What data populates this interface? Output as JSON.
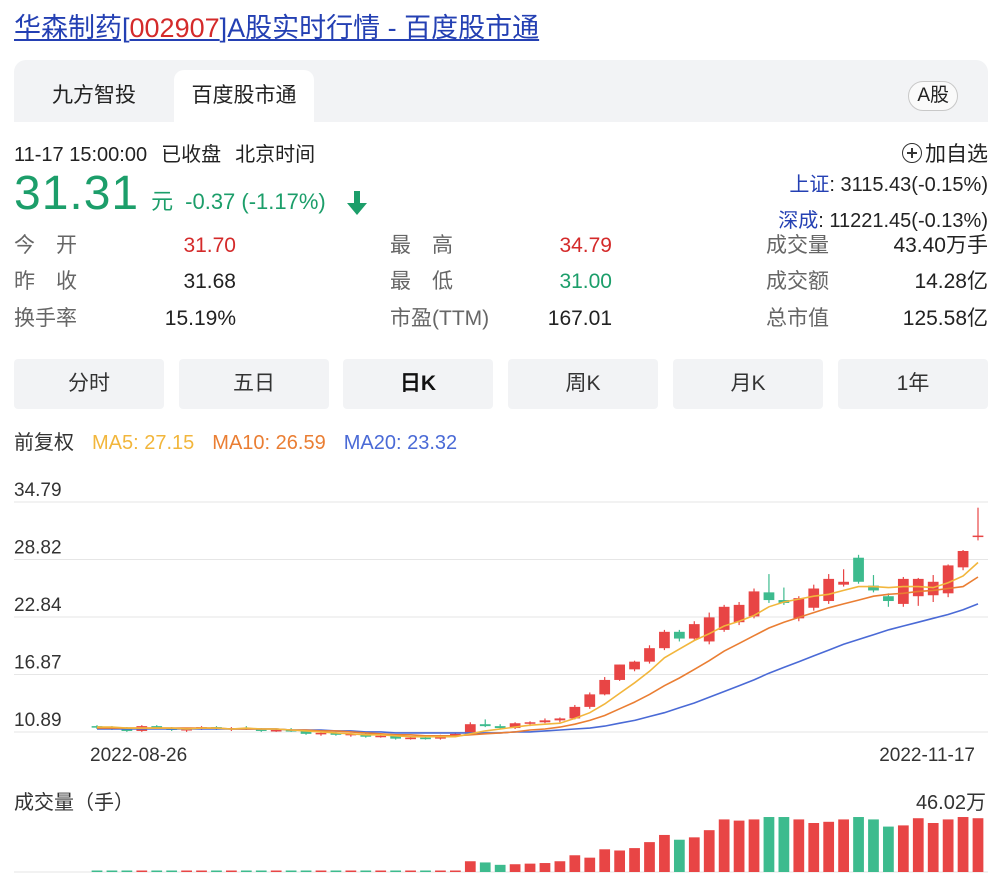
{
  "page": {
    "title_prefix": "华森制药[",
    "code": "002907",
    "title_suffix": "]A股实时行情 - 百度股市通"
  },
  "tabs": [
    "九方智投",
    "百度股市通"
  ],
  "share_type": "A股",
  "status": {
    "time": "11-17 15:00:00",
    "state": "已收盘",
    "zone": "北京时间"
  },
  "add_favorite": "加自选",
  "quote": {
    "price": "31.31",
    "unit": "元",
    "change": "-0.37 (-1.17%)",
    "direction": "down"
  },
  "indices": [
    {
      "name": "上证",
      "value": ": 3115.43(-0.15%)"
    },
    {
      "name": "深成",
      "value": ": 11221.45(-0.13%)"
    }
  ],
  "stats": {
    "open_label": "今　开",
    "open": "31.70",
    "prev_label": "昨　收",
    "prev": "31.68",
    "turnover_label": "换手率",
    "turnover": "15.19%",
    "high_label": "最　高",
    "high": "34.79",
    "low_label": "最　低",
    "low": "31.00",
    "pe_label": "市盈(TTM)",
    "pe": "167.01",
    "volume_label": "成交量",
    "volume": "43.40万手",
    "amount_label": "成交额",
    "amount": "14.28亿",
    "mcap_label": "总市值",
    "mcap": "125.58亿"
  },
  "periods": [
    "分时",
    "五日",
    "日K",
    "周K",
    "月K",
    "1年"
  ],
  "active_period": "日K",
  "ma": {
    "adjust": "前复权",
    "ma5": "MA5: 27.15",
    "ma10": "MA10: 26.59",
    "ma20": "MA20: 23.32"
  },
  "colors": {
    "up": "#e84545",
    "down": "#3dbb8e",
    "ma5": "#f2b63c",
    "ma10": "#ea7e33",
    "ma20": "#4a6ad6",
    "link": "#2440b3"
  },
  "chart_data": {
    "type": "candlestick",
    "y_ticks": [
      "34.79",
      "28.82",
      "22.84",
      "16.87",
      "10.89"
    ],
    "ylim": [
      10.89,
      34.79
    ],
    "x_labels": [
      "2022-08-26",
      "2022-11-17"
    ],
    "volume_title": "成交量（手）",
    "volume_max_label": "46.02万",
    "volume_max": 46.02,
    "candles": [
      [
        11.5,
        11.6,
        11.2,
        11.4
      ],
      [
        11.4,
        11.5,
        11.1,
        11.3
      ],
      [
        11.3,
        11.4,
        10.9,
        11.0
      ],
      [
        11.0,
        11.6,
        10.9,
        11.5
      ],
      [
        11.5,
        11.6,
        11.2,
        11.3
      ],
      [
        11.3,
        11.4,
        11.0,
        11.1
      ],
      [
        11.1,
        11.3,
        10.9,
        11.2
      ],
      [
        11.2,
        11.5,
        11.1,
        11.4
      ],
      [
        11.4,
        11.5,
        11.1,
        11.2
      ],
      [
        11.2,
        11.4,
        11.0,
        11.3
      ],
      [
        11.3,
        11.5,
        11.1,
        11.2
      ],
      [
        11.2,
        11.3,
        10.9,
        11.0
      ],
      [
        11.0,
        11.2,
        10.9,
        11.1
      ],
      [
        11.1,
        11.3,
        10.9,
        11.0
      ],
      [
        11.0,
        11.1,
        10.6,
        10.7
      ],
      [
        10.7,
        10.9,
        10.5,
        10.8
      ],
      [
        10.8,
        10.9,
        10.5,
        10.6
      ],
      [
        10.6,
        10.8,
        10.4,
        10.7
      ],
      [
        10.7,
        10.8,
        10.3,
        10.4
      ],
      [
        10.4,
        10.6,
        10.3,
        10.5
      ],
      [
        10.5,
        10.6,
        10.1,
        10.2
      ],
      [
        10.2,
        10.4,
        10.1,
        10.3
      ],
      [
        10.3,
        10.5,
        10.1,
        10.2
      ],
      [
        10.2,
        10.6,
        10.1,
        10.5
      ],
      [
        10.5,
        10.8,
        10.4,
        10.7
      ],
      [
        10.7,
        11.9,
        10.6,
        11.7
      ],
      [
        11.7,
        12.2,
        11.4,
        11.5
      ],
      [
        11.5,
        11.7,
        11.2,
        11.3
      ],
      [
        11.3,
        11.9,
        11.2,
        11.8
      ],
      [
        11.8,
        12.0,
        11.5,
        11.9
      ],
      [
        11.9,
        12.3,
        11.8,
        12.1
      ],
      [
        12.1,
        12.4,
        11.9,
        12.3
      ],
      [
        12.3,
        13.7,
        12.2,
        13.5
      ],
      [
        13.5,
        15.0,
        13.3,
        14.8
      ],
      [
        14.8,
        16.6,
        14.7,
        16.3
      ],
      [
        16.3,
        17.9,
        16.2,
        17.9
      ],
      [
        17.4,
        18.3,
        17.2,
        18.2
      ],
      [
        18.2,
        19.9,
        18.0,
        19.6
      ],
      [
        19.6,
        21.5,
        19.4,
        21.3
      ],
      [
        21.3,
        21.5,
        20.3,
        20.6
      ],
      [
        20.6,
        22.4,
        20.5,
        22.1
      ],
      [
        20.3,
        23.3,
        20.0,
        22.8
      ],
      [
        21.5,
        24.1,
        21.3,
        23.9
      ],
      [
        22.3,
        24.4,
        22.0,
        24.1
      ],
      [
        22.9,
        25.8,
        22.7,
        25.5
      ],
      [
        25.4,
        27.3,
        24.3,
        24.6
      ],
      [
        24.6,
        25.9,
        24.1,
        24.3
      ],
      [
        22.7,
        25.0,
        22.4,
        24.8
      ],
      [
        23.8,
        26.2,
        23.5,
        25.8
      ],
      [
        24.5,
        27.3,
        24.2,
        26.8
      ],
      [
        26.2,
        27.8,
        26.0,
        26.5
      ],
      [
        29.0,
        29.3,
        26.3,
        26.5
      ],
      [
        26.1,
        27.2,
        25.4,
        25.6
      ],
      [
        25.0,
        25.3,
        23.9,
        24.5
      ],
      [
        24.2,
        27.0,
        23.9,
        26.8
      ],
      [
        25.0,
        26.9,
        24.0,
        26.8
      ],
      [
        25.1,
        27.2,
        24.4,
        26.5
      ],
      [
        25.3,
        28.3,
        24.9,
        28.2
      ],
      [
        28.0,
        29.8,
        27.7,
        29.7
      ],
      [
        31.2,
        34.2,
        30.8,
        31.3
      ]
    ],
    "ma5": [
      11.4,
      11.4,
      11.3,
      11.3,
      11.3,
      11.3,
      11.2,
      11.3,
      11.3,
      11.2,
      11.3,
      11.2,
      11.2,
      11.1,
      11.0,
      10.9,
      10.8,
      10.7,
      10.6,
      10.6,
      10.5,
      10.4,
      10.4,
      10.4,
      10.4,
      10.7,
      11.0,
      11.2,
      11.4,
      11.6,
      11.7,
      11.8,
      12.3,
      12.9,
      13.8,
      14.9,
      16.0,
      17.2,
      18.6,
      19.5,
      20.4,
      21.1,
      21.9,
      22.4,
      23.0,
      23.9,
      24.4,
      24.7,
      25.0,
      25.2,
      25.6,
      26.0,
      26.0,
      25.9,
      26.0,
      26.0,
      25.9,
      26.4,
      27.1,
      28.5
    ],
    "ma10": [
      11.3,
      11.3,
      11.3,
      11.3,
      11.3,
      11.3,
      11.3,
      11.3,
      11.3,
      11.2,
      11.2,
      11.2,
      11.2,
      11.1,
      11.1,
      11.0,
      11.0,
      10.9,
      10.8,
      10.7,
      10.6,
      10.6,
      10.5,
      10.5,
      10.5,
      10.6,
      10.7,
      10.8,
      10.9,
      11.1,
      11.2,
      11.4,
      11.7,
      12.1,
      12.6,
      13.3,
      14.0,
      14.8,
      15.7,
      16.5,
      17.4,
      18.3,
      19.3,
      20.1,
      20.9,
      21.7,
      22.3,
      22.8,
      23.3,
      23.8,
      24.2,
      24.6,
      25.0,
      25.2,
      25.3,
      25.5,
      25.6,
      25.8,
      26.0,
      27.0
    ],
    "ma20": [
      11.2,
      11.2,
      11.2,
      11.2,
      11.2,
      11.2,
      11.2,
      11.2,
      11.2,
      11.2,
      11.2,
      11.2,
      11.2,
      11.1,
      11.1,
      11.1,
      11.0,
      11.0,
      10.9,
      10.9,
      10.8,
      10.8,
      10.8,
      10.8,
      10.8,
      10.8,
      10.8,
      10.8,
      10.9,
      10.9,
      11.0,
      11.1,
      11.2,
      11.3,
      11.5,
      11.8,
      12.1,
      12.5,
      12.9,
      13.4,
      13.9,
      14.5,
      15.1,
      15.7,
      16.3,
      17.0,
      17.6,
      18.2,
      18.8,
      19.4,
      20.0,
      20.5,
      21.0,
      21.5,
      21.9,
      22.3,
      22.7,
      23.1,
      23.6,
      24.2
    ],
    "volumes": [
      1.0,
      0.9,
      0.8,
      1.2,
      1.0,
      0.9,
      0.8,
      0.9,
      0.8,
      0.7,
      0.8,
      0.7,
      0.7,
      0.6,
      0.6,
      0.5,
      0.5,
      0.5,
      0.5,
      0.5,
      0.4,
      0.4,
      0.4,
      0.5,
      0.8,
      9.0,
      8.0,
      6.0,
      6.5,
      7.0,
      7.5,
      9.0,
      14.0,
      12.0,
      19.0,
      18.0,
      20.0,
      25.0,
      31.0,
      27.0,
      29.0,
      35.0,
      44.0,
      43.0,
      44.0,
      46.0,
      46.0,
      44.0,
      41.0,
      42.0,
      44.0,
      46.0,
      44.0,
      38.0,
      39.0,
      45.0,
      41.0,
      44.0,
      46.0,
      45.0
    ]
  }
}
